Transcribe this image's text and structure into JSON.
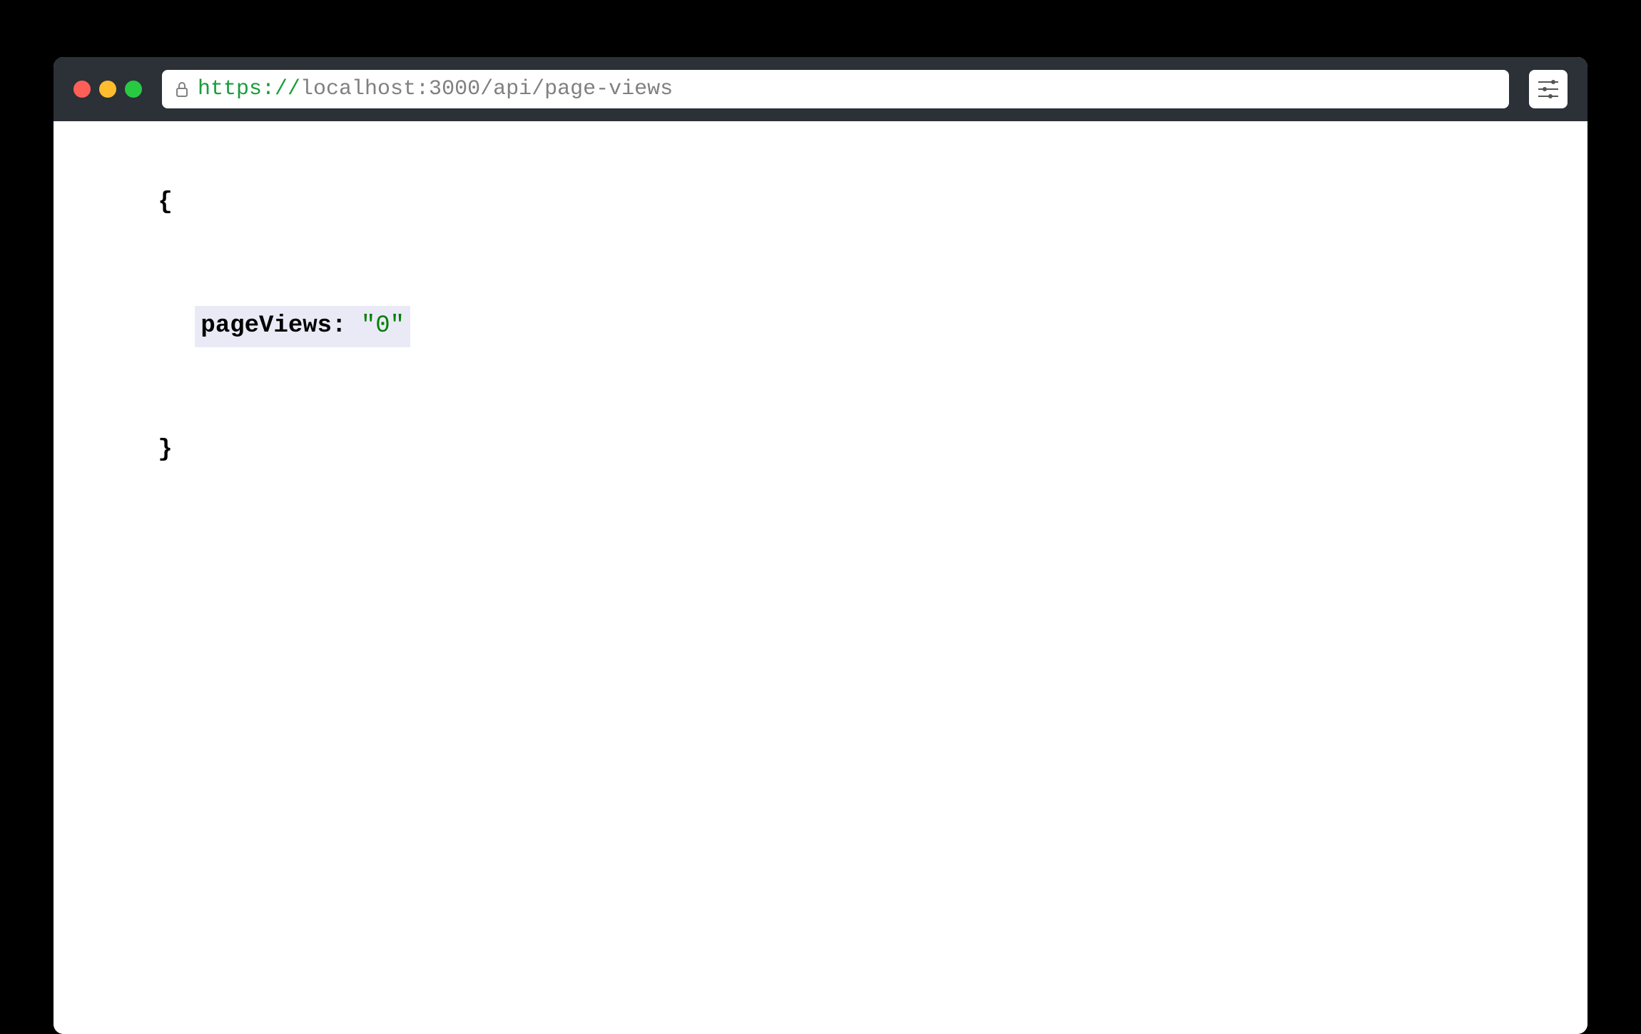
{
  "titleBar": {
    "url": {
      "protocol": "https://",
      "rest": "localhost:3000/api/page-views"
    }
  },
  "content": {
    "braceOpen": "{",
    "braceClose": "}",
    "properties": [
      {
        "key": "pageViews:",
        "value": "\"0\""
      }
    ]
  }
}
